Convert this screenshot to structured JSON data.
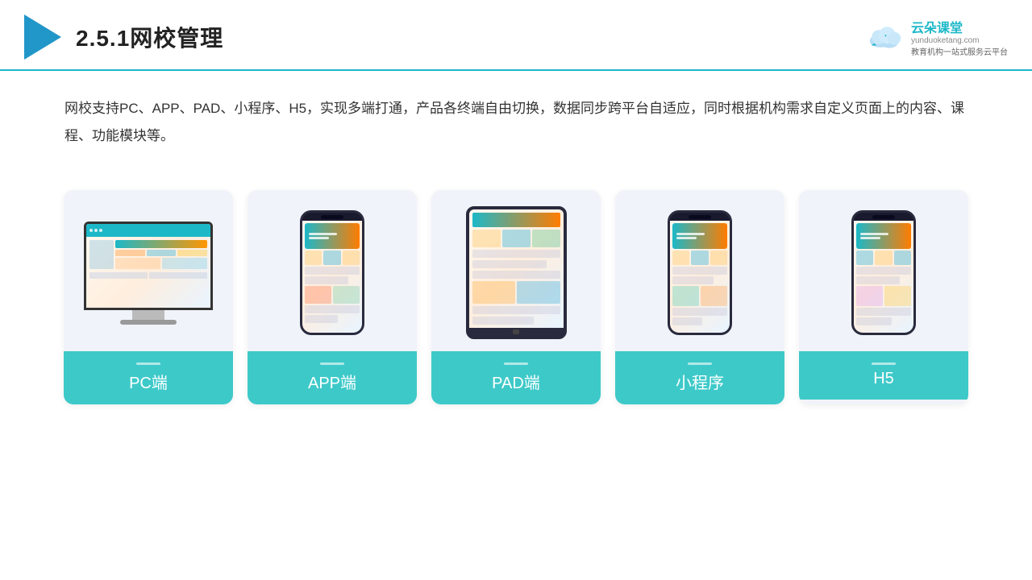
{
  "header": {
    "title_prefix": "2.5.1",
    "title_main": "网校管理",
    "brand_name": "云朵课堂",
    "brand_url": "yunduoketang.com",
    "brand_tagline1": "教育机构一站",
    "brand_tagline2": "式服务云平台"
  },
  "description": {
    "text": "网校支持PC、APP、PAD、小程序、H5，实现多端打通，产品各终端自由切换，数据同步跨平台自适应，同时根据机构需求自定义页面上的内容、课程、功能模块等。"
  },
  "cards": [
    {
      "id": "pc",
      "label": "PC端"
    },
    {
      "id": "app",
      "label": "APP端"
    },
    {
      "id": "pad",
      "label": "PAD端"
    },
    {
      "id": "miniapp",
      "label": "小程序"
    },
    {
      "id": "h5",
      "label": "H5"
    }
  ],
  "colors": {
    "accent": "#1cb8c8",
    "card_label_bg": "#3ec9c9",
    "card_bg": "#f0f4fa",
    "title_color": "#222"
  }
}
